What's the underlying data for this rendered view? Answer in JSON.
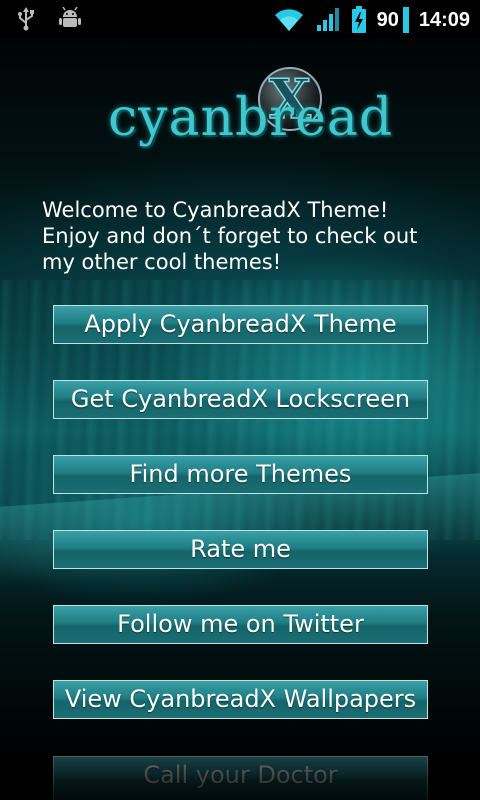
{
  "status_bar": {
    "battery_level": "90",
    "time": "14:09",
    "icons": [
      "usb-icon",
      "android-debug-icon",
      "wifi-icon",
      "signal-icon",
      "battery-charging-icon"
    ]
  },
  "logo": {
    "word": "cyanbread",
    "mark": "X"
  },
  "welcome": {
    "text": "Welcome to CyanbreadX Theme! Enjoy and don´t forget to check out my other cool themes!"
  },
  "buttons": [
    {
      "label": "Apply CyanbreadX Theme"
    },
    {
      "label": "Get CyanbreadX Lockscreen"
    },
    {
      "label": "Find more Themes"
    },
    {
      "label": "Rate me"
    },
    {
      "label": "Follow me on Twitter"
    },
    {
      "label": "View CyanbreadX Wallpapers"
    },
    {
      "label": "Call your Doctor"
    }
  ],
  "colors": {
    "accent": "#3fc9cf",
    "button_top": "#3aa0a7",
    "button_bottom": "#146469",
    "button_border": "#bfe3e3"
  }
}
